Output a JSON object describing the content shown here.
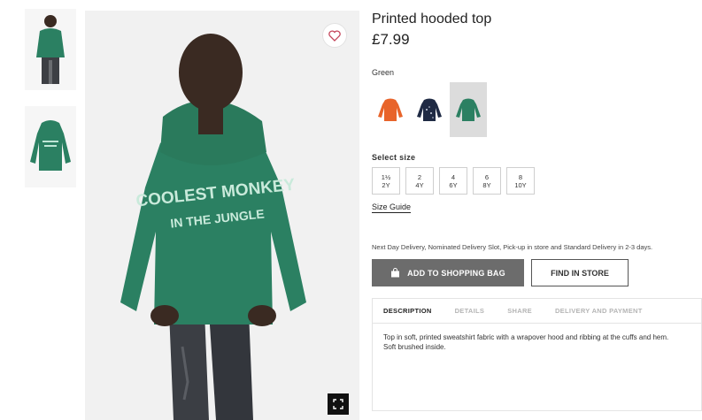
{
  "product": {
    "title": "Printed hooded top",
    "price": "£7.99",
    "color_label": "Green",
    "swatches": [
      {
        "name": "orange",
        "color": "#e8642a"
      },
      {
        "name": "navy",
        "color": "#1f2a44"
      },
      {
        "name": "green",
        "color": "#2a7d5f",
        "selected": true
      }
    ],
    "hoodie_color": "#2b8062",
    "print_line_1": "COOLEST MONKEY",
    "print_line_2": "IN THE JUNGLE"
  },
  "size": {
    "label": "Select size",
    "options": [
      {
        "top": "1½",
        "bottom": "2Y"
      },
      {
        "top": "2",
        "bottom": "4Y"
      },
      {
        "top": "4",
        "bottom": "6Y"
      },
      {
        "top": "6",
        "bottom": "8Y"
      },
      {
        "top": "8",
        "bottom": "10Y"
      }
    ],
    "guide": "Size Guide"
  },
  "delivery_text": "Next Day Delivery, Nominated Delivery Slot, Pick-up in store and Standard Delivery in 2-3 days.",
  "actions": {
    "add_to_bag": "ADD TO SHOPPING BAG",
    "find_in_store": "FIND IN STORE"
  },
  "tabs": [
    "DESCRIPTION",
    "DETAILS",
    "SHARE",
    "DELIVERY AND PAYMENT"
  ],
  "description": "Top in soft, printed sweatshirt fabric with a wrapover hood and ribbing at the cuffs and hem. Soft brushed inside.",
  "icons": {
    "favorite": "heart-icon",
    "zoom": "expand-icon",
    "bag": "shopping-bag-icon"
  }
}
